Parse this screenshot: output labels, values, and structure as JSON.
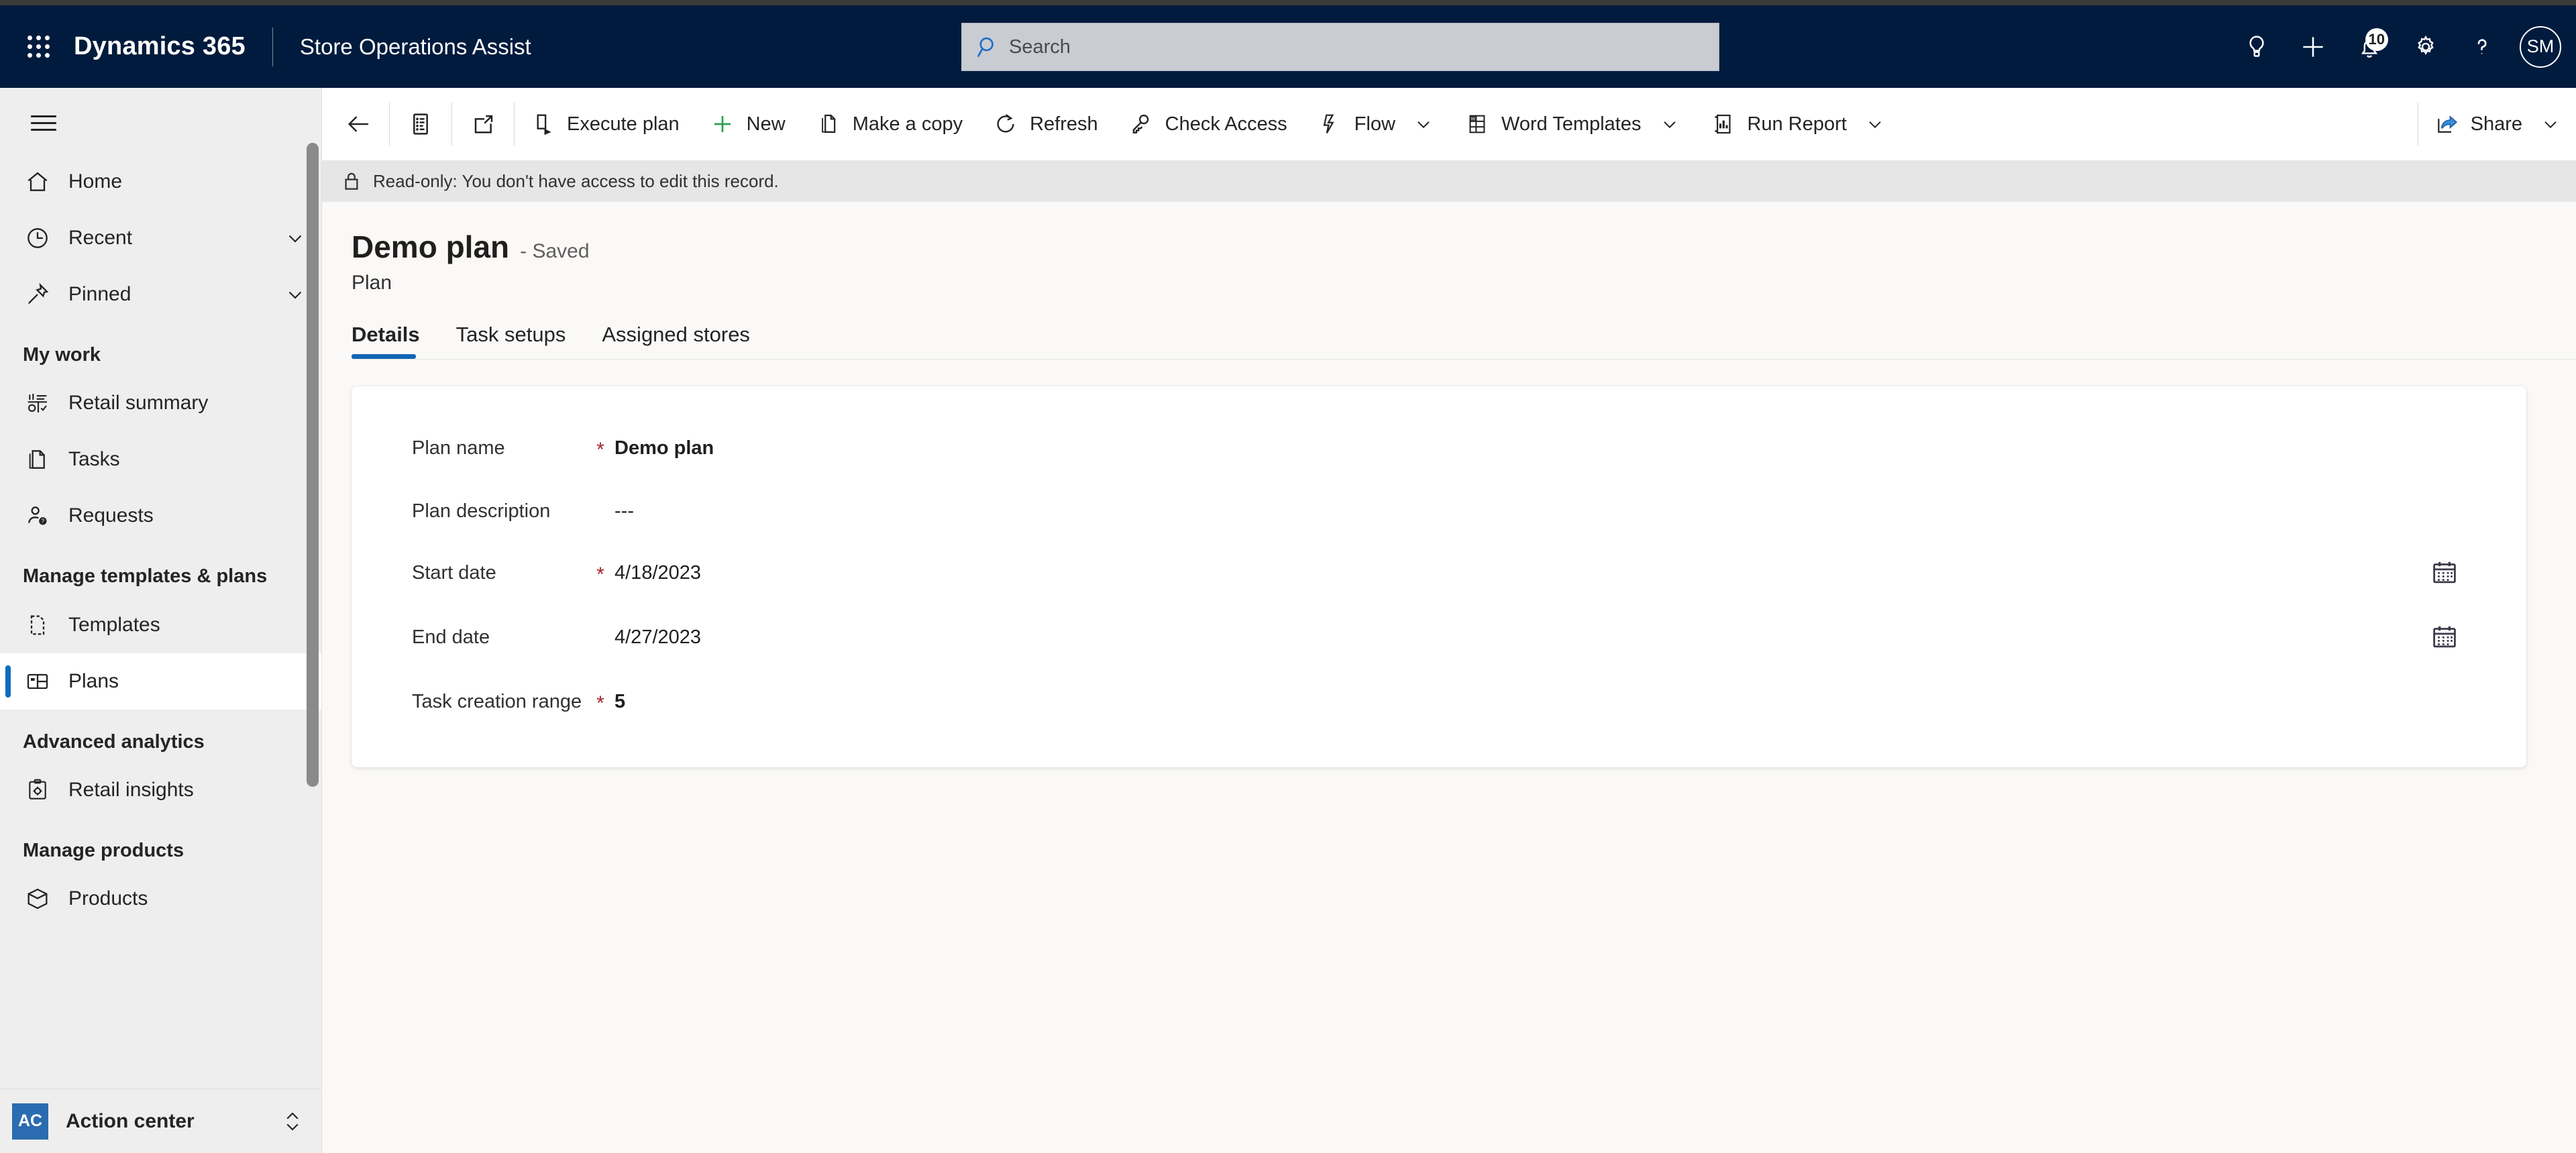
{
  "header": {
    "waffle_label": "app-launcher",
    "brand": "Dynamics 365",
    "app_name": "Store Operations Assist",
    "search": {
      "placeholder": "Search",
      "value": ""
    },
    "actions": [
      {
        "name": "tips-icon",
        "label": "Tips"
      },
      {
        "name": "quick-create-icon",
        "label": "New"
      },
      {
        "name": "notifications-icon",
        "label": "Notifications",
        "badge": "10"
      },
      {
        "name": "settings-gear-icon",
        "label": "Settings"
      },
      {
        "name": "help-icon",
        "label": "Help"
      }
    ],
    "avatar_initials": "SM"
  },
  "sidebar": {
    "hamburger_label": "Expand / collapse site map",
    "items": [
      {
        "type": "item",
        "label": "Home",
        "icon": "home-icon"
      },
      {
        "type": "item",
        "label": "Recent",
        "icon": "clock-icon",
        "chevron": true
      },
      {
        "type": "item",
        "label": "Pinned",
        "icon": "pin-icon",
        "chevron": true
      },
      {
        "type": "group",
        "label": "My work"
      },
      {
        "type": "item",
        "label": "Retail summary",
        "icon": "retail-summary-icon"
      },
      {
        "type": "item",
        "label": "Tasks",
        "icon": "tasks-icon"
      },
      {
        "type": "item",
        "label": "Requests",
        "icon": "requests-icon"
      },
      {
        "type": "group",
        "label": "Manage templates & plans"
      },
      {
        "type": "item",
        "label": "Templates",
        "icon": "templates-icon"
      },
      {
        "type": "item",
        "label": "Plans",
        "icon": "plans-icon",
        "selected": true
      },
      {
        "type": "group",
        "label": "Advanced analytics"
      },
      {
        "type": "item",
        "label": "Retail insights",
        "icon": "retail-insights-icon"
      },
      {
        "type": "group",
        "label": "Manage products"
      },
      {
        "type": "item",
        "label": "Products",
        "icon": "products-icon"
      }
    ],
    "footer": {
      "badge": "AC",
      "label": "Action center",
      "chevron": "up-down-chevron-icon"
    }
  },
  "commandbar": {
    "icon_buttons": [
      {
        "name": "back-button",
        "label": "Back"
      },
      {
        "name": "form-selector-button",
        "label": "Form"
      },
      {
        "name": "popout-button",
        "label": "Open in new window"
      }
    ],
    "buttons": [
      {
        "label": "Execute plan",
        "icon": "execute-plan-icon",
        "chevron": false
      },
      {
        "label": "New",
        "icon": "plus-icon",
        "chevron": false
      },
      {
        "label": "Make a copy",
        "icon": "copy-icon",
        "chevron": false
      },
      {
        "label": "Refresh",
        "icon": "refresh-icon",
        "chevron": false
      },
      {
        "label": "Check Access",
        "icon": "key-icon",
        "chevron": false
      },
      {
        "label": "Flow",
        "icon": "flow-icon",
        "chevron": true
      },
      {
        "label": "Word Templates",
        "icon": "word-icon",
        "chevron": true
      },
      {
        "label": "Run Report",
        "icon": "report-icon",
        "chevron": true
      }
    ],
    "share": {
      "label": "Share",
      "icon": "share-icon",
      "chevron": true
    }
  },
  "banner": {
    "icon": "lock-icon",
    "text": "Read-only: You don't have access to edit this record."
  },
  "record": {
    "title": "Demo plan",
    "save_state": "- Saved",
    "entity": "Plan"
  },
  "tabs": [
    {
      "label": "Details",
      "active": true
    },
    {
      "label": "Task setups",
      "active": false
    },
    {
      "label": "Assigned stores",
      "active": false
    }
  ],
  "form": {
    "fields": [
      {
        "label": "Plan name",
        "required": true,
        "value": "Demo plan",
        "bold": true,
        "calendar": false
      },
      {
        "label": "Plan description",
        "required": false,
        "value": "---",
        "bold": false,
        "calendar": false
      },
      {
        "label": "Start date",
        "required": true,
        "value": "4/18/2023",
        "bold": false,
        "calendar": true
      },
      {
        "label": "End date",
        "required": false,
        "value": "4/27/2023",
        "bold": false,
        "calendar": true
      },
      {
        "label": "Task creation range",
        "required": true,
        "value": "5",
        "bold": true,
        "calendar": false
      }
    ],
    "required_marker": "*"
  },
  "colors": {
    "header_navy": "#001b3d",
    "accent_blue": "#0f6cbd",
    "tab_underline": "#1266b5",
    "required_red": "#a4262c",
    "new_green": "#2e9e4f",
    "banner_gray": "#e6e6e6",
    "sidebar_gray": "#eeeeee",
    "canvas": "#faf9f8",
    "action_center_badge": "#2b6cb0"
  }
}
